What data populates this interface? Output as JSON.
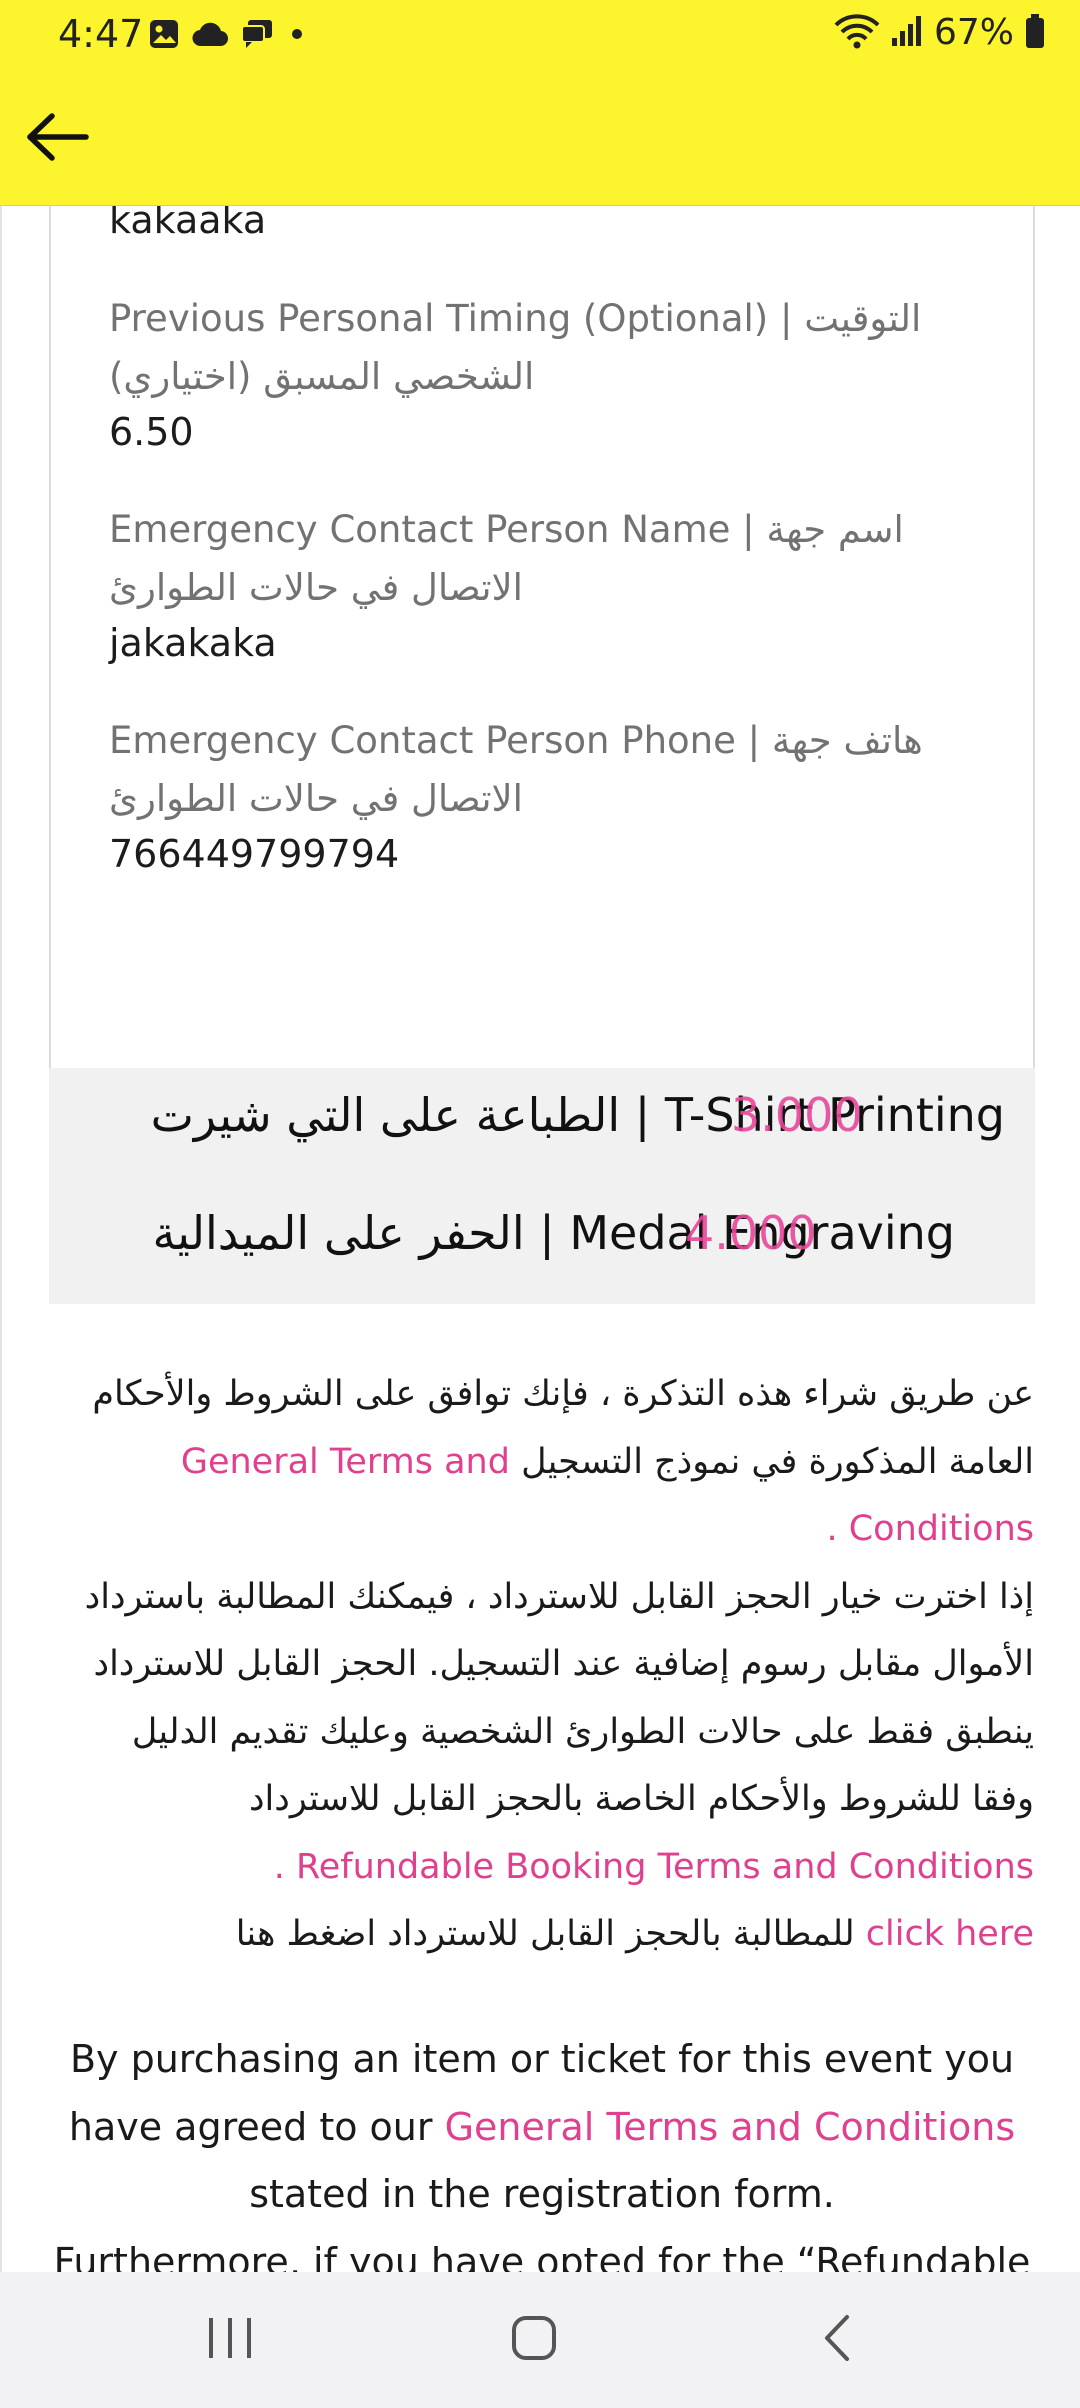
{
  "status_bar": {
    "time": "4:47",
    "battery": "67%",
    "icons": [
      "gallery-icon",
      "cloud-icon",
      "chat-icon",
      "dot-icon",
      "wifi-icon",
      "signal-icon",
      "battery-icon"
    ]
  },
  "app_bar": {
    "back_icon": "arrow-left-icon",
    "background": "#fcf42c"
  },
  "details": {
    "top_value": "kakaaka",
    "fields": [
      {
        "label_line1": "Previous Personal Timing (Optional) | التوقيت",
        "label_line2": "الشخصي المسبق (اختياري)",
        "value": "6.50"
      },
      {
        "label_line1": "Emergency Contact Person Name | اسم جهة",
        "label_line2": "الاتصال في حالات الطوارئ",
        "value": "jakakaka"
      },
      {
        "label_line1": "Emergency Contact Person Phone | هاتف جهة",
        "label_line2": "الاتصال في حالات الطوارئ",
        "value": "766449799794"
      }
    ]
  },
  "addons": [
    {
      "name": "T-Shirt Printing | الطباعة على التي شيرت",
      "price": "3.000"
    },
    {
      "name": "Medal Engraving | الحفر على الميدالية",
      "price": "4.000"
    }
  ],
  "terms_ar": {
    "p1_text": "عن طريق شراء هذه التذكرة ، فإنك توافق على الشروط والأحكام العامة المذكورة في نموذج التسجيل",
    "p1_link": "General Terms and Conditions",
    "p1_end": ".",
    "p2_text": "إذا اخترت خيار الحجز القابل للاسترداد ، فيمكنك المطالبة باسترداد الأموال مقابل رسوم إضافية عند التسجيل. الحجز القابل للاسترداد ينطبق فقط على حالات الطوارئ الشخصية وعليك تقديم الدليل وفقا للشروط والأحكام الخاصة بالحجز القابل للاسترداد",
    "p2_link": "Refundable Booking Terms and Conditions",
    "p2_end": ".",
    "p3_text": "للمطالبة بالحجز القابل للاسترداد اضغط هنا",
    "p3_link": "click here"
  },
  "terms_en": {
    "line1": "By purchasing an item or ticket for this event you have agreed to our",
    "link": "General Terms and Conditions",
    "line2": "stated in the registration form.",
    "line3": "Furthermore, if you have opted for the “Refundable"
  },
  "nav_bar": {
    "icons": [
      "recent-apps-icon",
      "home-icon",
      "back-nav-icon"
    ]
  },
  "colors": {
    "accent_yellow": "#fcf42c",
    "link_pink": "#e0418f"
  }
}
